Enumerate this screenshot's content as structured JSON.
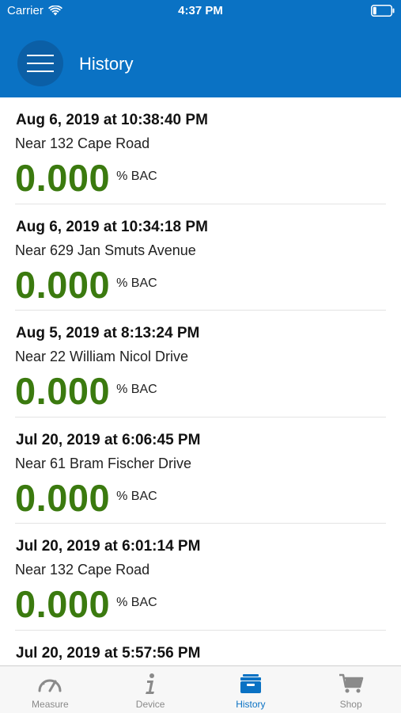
{
  "status_bar": {
    "carrier": "Carrier",
    "time": "4:37 PM"
  },
  "header": {
    "title": "History"
  },
  "entries": [
    {
      "date": "Aug 6, 2019 at 10:38:40 PM",
      "location": "Near 132 Cape Road",
      "bac": "0.000",
      "unit": "% BAC"
    },
    {
      "date": "Aug 6, 2019 at 10:34:18 PM",
      "location": "Near 629 Jan Smuts Avenue",
      "bac": "0.000",
      "unit": "% BAC"
    },
    {
      "date": "Aug 5, 2019 at 8:13:24 PM",
      "location": "Near 22 William Nicol Drive",
      "bac": "0.000",
      "unit": "% BAC"
    },
    {
      "date": "Jul 20, 2019 at 6:06:45 PM",
      "location": "Near 61 Bram Fischer Drive",
      "bac": "0.000",
      "unit": "% BAC"
    },
    {
      "date": "Jul 20, 2019 at 6:01:14 PM",
      "location": "Near 132 Cape Road",
      "bac": "0.000",
      "unit": "% BAC"
    },
    {
      "date": "Jul 20, 2019 at 5:57:56 PM",
      "location": "",
      "bac": "",
      "unit": ""
    }
  ],
  "tabs": [
    {
      "label": "Measure",
      "icon": "gauge-icon",
      "active": false
    },
    {
      "label": "Device",
      "icon": "info-icon",
      "active": false
    },
    {
      "label": "History",
      "icon": "history-box-icon",
      "active": true
    },
    {
      "label": "Shop",
      "icon": "cart-icon",
      "active": false
    }
  ],
  "colors": {
    "header": "#0a72c4",
    "menu_button": "#0b5fa6",
    "bac_value": "#3b7a0f",
    "active_tab": "#0a72c4",
    "inactive_tab": "#8a8a8a"
  }
}
